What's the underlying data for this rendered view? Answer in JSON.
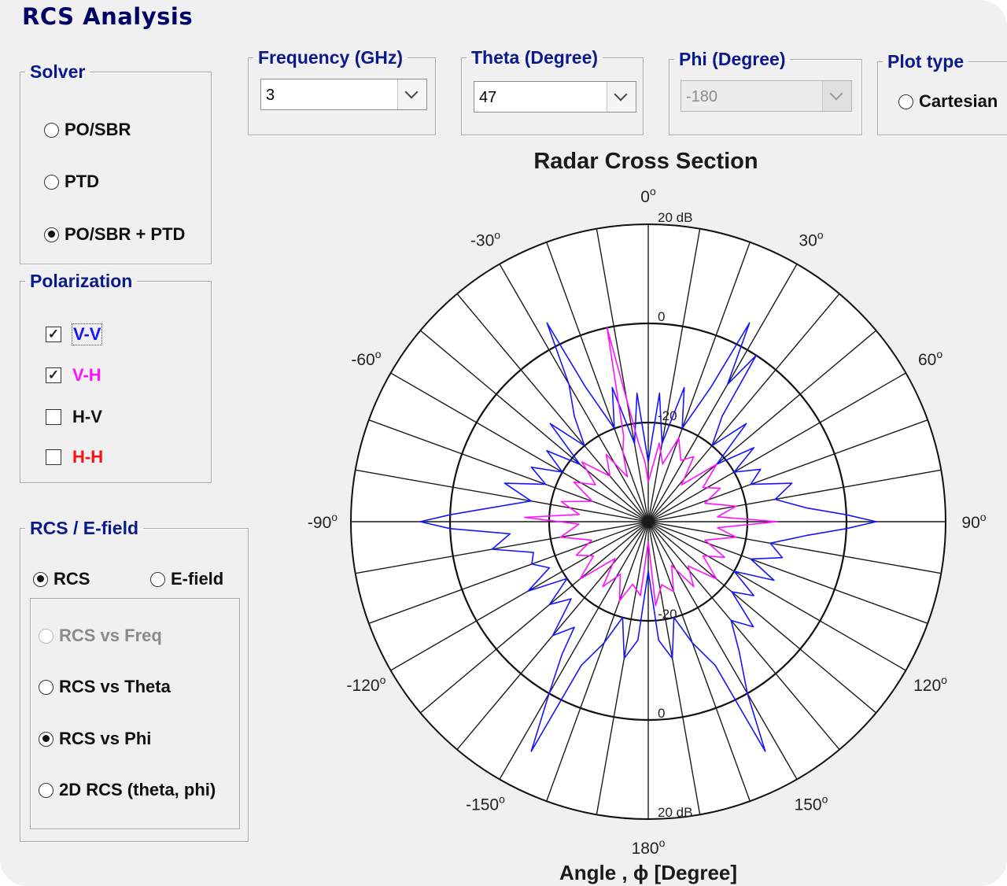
{
  "app": {
    "title": "RCS Analysis"
  },
  "solver": {
    "legend": "Solver",
    "options": [
      {
        "label": "PO/SBR",
        "selected": false
      },
      {
        "label": "PTD",
        "selected": false
      },
      {
        "label": "PO/SBR + PTD",
        "selected": true
      }
    ]
  },
  "polarization": {
    "legend": "Polarization",
    "items": [
      {
        "label": "V-V",
        "checked": true,
        "color": "#1515ff"
      },
      {
        "label": "V-H",
        "checked": true,
        "color": "#ff10ff"
      },
      {
        "label": "H-V",
        "checked": false,
        "color": "#111111"
      },
      {
        "label": "H-H",
        "checked": false,
        "color": "#ff1010"
      }
    ]
  },
  "rcs_efield": {
    "legend": "RCS / E-field",
    "options": [
      {
        "label": "RCS",
        "selected": true
      },
      {
        "label": "E-field",
        "selected": false
      }
    ],
    "sub_options": [
      {
        "label": "RCS vs Freq",
        "selected": false,
        "disabled": true
      },
      {
        "label": "RCS vs Theta",
        "selected": false,
        "disabled": false
      },
      {
        "label": "RCS vs Phi",
        "selected": true,
        "disabled": false
      },
      {
        "label": "2D RCS (theta, phi)",
        "selected": false,
        "disabled": false
      }
    ]
  },
  "frequency": {
    "legend": "Frequency (GHz)",
    "value": "3"
  },
  "theta": {
    "legend": "Theta (Degree)",
    "value": "47"
  },
  "phi": {
    "legend": "Phi (Degree)",
    "value": "-180",
    "disabled": true
  },
  "plot_type": {
    "legend": "Plot type",
    "option": "Cartesian",
    "selected": false
  },
  "chart_data": {
    "type": "polar",
    "title": "Radar Cross Section",
    "xlabel": "Angle , ϕ  [Degree]",
    "angle_tick_labels": [
      {
        "angle": 0,
        "text": "0"
      },
      {
        "angle": 30,
        "text": "30"
      },
      {
        "angle": 60,
        "text": "60"
      },
      {
        "angle": 90,
        "text": "90"
      },
      {
        "angle": 120,
        "text": "120"
      },
      {
        "angle": 150,
        "text": "150"
      },
      {
        "angle": 180,
        "text": "180"
      },
      {
        "angle": -150,
        "text": "-150"
      },
      {
        "angle": -120,
        "text": "-120"
      },
      {
        "angle": -90,
        "text": "-90"
      },
      {
        "angle": -60,
        "text": "-60"
      },
      {
        "angle": -30,
        "text": "-30"
      }
    ],
    "angle_grid_step_deg": 10,
    "radial_range_db": [
      -40,
      20
    ],
    "radial_rings_db": [
      -20,
      0,
      20
    ],
    "radial_tick_labels": [
      {
        "angle": 0,
        "text": "20 dB"
      },
      {
        "angle": 0,
        "text": "0"
      },
      {
        "angle": 0,
        "text": "-20"
      },
      {
        "angle": 180,
        "text": "-20"
      },
      {
        "angle": 180,
        "text": "0"
      },
      {
        "angle": 180,
        "text": "20 dB"
      }
    ],
    "series": [
      {
        "name": "V-V",
        "color": "#1515ff",
        "angles": [
          0,
          5,
          10,
          15,
          20,
          25,
          27,
          30,
          33,
          35,
          40,
          45,
          50,
          55,
          60,
          65,
          70,
          75,
          80,
          85,
          88,
          90,
          92,
          95,
          100,
          105,
          110,
          115,
          120,
          125,
          130,
          135,
          140,
          145,
          150,
          153,
          155,
          160,
          165,
          170,
          175,
          180,
          185,
          190,
          195,
          200,
          205,
          207,
          210,
          213,
          215,
          220,
          225,
          230,
          235,
          240,
          245,
          250,
          255,
          260,
          265,
          268,
          270,
          272,
          275,
          280,
          285,
          290,
          295,
          300,
          305,
          310,
          315,
          320,
          325,
          330,
          333,
          335,
          340,
          345,
          350,
          355
        ],
        "values": [
          -28,
          -14,
          -24,
          -12,
          -20,
          -10,
          5,
          -8,
          0,
          -14,
          -20,
          -12,
          -22,
          -14,
          -20,
          -15,
          -18,
          -10,
          -14,
          -8,
          0,
          6,
          0,
          -8,
          -15,
          -12,
          -18,
          -12,
          -20,
          -14,
          -18,
          -10,
          -14,
          -8,
          0,
          12,
          -8,
          -14,
          -20,
          -12,
          -16,
          -30,
          -16,
          -12,
          -20,
          -14,
          -8,
          12,
          0,
          -8,
          -14,
          -10,
          -18,
          -14,
          -20,
          -12,
          -18,
          -15,
          -16,
          -8,
          -12,
          0,
          6,
          0,
          -8,
          -16,
          -10,
          -18,
          -14,
          -20,
          -15,
          -22,
          -12,
          -20,
          -14,
          -8,
          5,
          -10,
          -20,
          -12,
          -24,
          -14
        ]
      },
      {
        "name": "V-H",
        "color": "#ff10ff",
        "angles": [
          0,
          8,
          14,
          20,
          28,
          35,
          42,
          50,
          58,
          65,
          72,
          80,
          86,
          90,
          95,
          100,
          108,
          115,
          122,
          130,
          138,
          145,
          152,
          160,
          168,
          175,
          180,
          186,
          194,
          200,
          208,
          215,
          222,
          230,
          238,
          245,
          252,
          260,
          268,
          272,
          276,
          283,
          290,
          298,
          305,
          312,
          320,
          328,
          335,
          340,
          344,
          348,
          353,
          357
        ],
        "values": [
          -32,
          -24,
          -28,
          -22,
          -26,
          -24,
          -30,
          -22,
          -27,
          -24,
          -28,
          -22,
          -26,
          -14,
          -26,
          -22,
          -28,
          -23,
          -27,
          -22,
          -28,
          -24,
          -30,
          -25,
          -27,
          -23,
          -36,
          -25,
          -27,
          -23,
          -28,
          -24,
          -30,
          -22,
          -27,
          -24,
          -28,
          -22,
          -26,
          -15,
          -26,
          -22,
          -28,
          -23,
          -27,
          -22,
          -28,
          -24,
          -30,
          -25,
          -22,
          0,
          -24,
          -28
        ]
      }
    ]
  }
}
